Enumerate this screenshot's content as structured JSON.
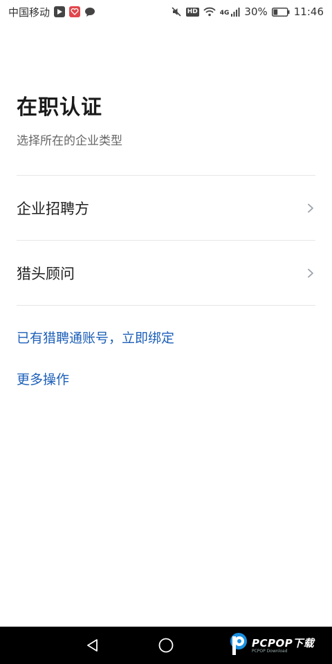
{
  "status_bar": {
    "carrier": "中国移动",
    "network": "4G",
    "hd": "HD",
    "battery": "30%",
    "time": "11:46",
    "battery_level": 0.3
  },
  "header": {
    "title": "在职认证",
    "subtitle": "选择所在的企业类型"
  },
  "options": [
    {
      "label": "企业招聘方"
    },
    {
      "label": "猎头顾问"
    }
  ],
  "links": {
    "bind_account": "已有猎聘通账号，立即绑定",
    "more_actions": "更多操作"
  },
  "watermark": {
    "text": "PCPOP下载",
    "sub": "PCPOP Download"
  },
  "colors": {
    "link": "#1c5fb8",
    "divider": "#e6e6e6",
    "nav_bar": "#000000"
  }
}
